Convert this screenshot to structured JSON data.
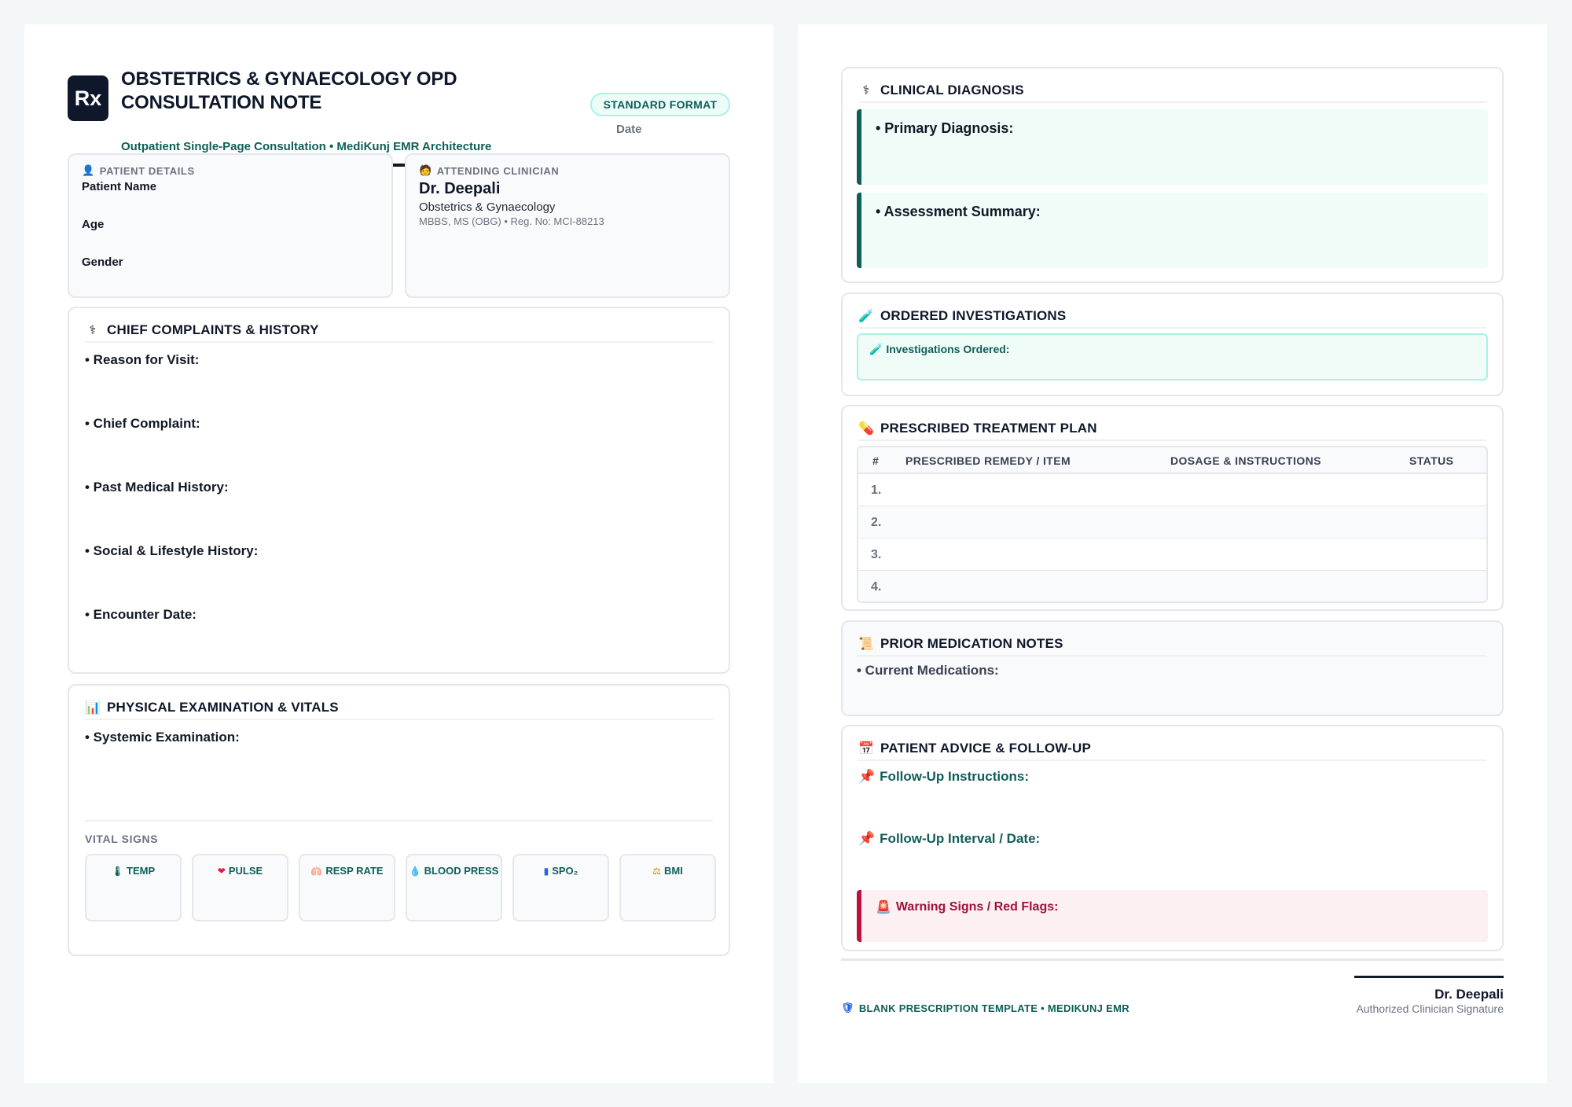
{
  "header": {
    "logo_text": "Rx",
    "title": "OBSTETRICS & GYNAECOLOGY OPD CONSULTATION NOTE",
    "subtitle": "Outpatient Single-Page Consultation • MediKunj EMR Architecture",
    "badge": "STANDARD FORMAT",
    "date_label": "Date"
  },
  "patient": {
    "caption": "PATIENT DETAILS",
    "icon": "person-icon",
    "fields": [
      "Patient Name",
      "Age",
      "Gender"
    ]
  },
  "clinician": {
    "caption": "ATTENDING CLINICIAN",
    "icon": "doctor-icon",
    "name": "Dr. Deepali",
    "specialty": "Obstetrics & Gynaecology",
    "credentials": "MBBS, MS (OBG) • Reg. No: MCI-88213"
  },
  "complaints": {
    "title": "CHIEF COMPLAINTS & HISTORY",
    "icon": "stethoscope-icon",
    "items": [
      "• Reason for Visit:",
      "• Chief Complaint:",
      "• Past Medical History:",
      "• Social & Lifestyle History:",
      "• Encounter Date:"
    ]
  },
  "exam": {
    "title": "PHYSICAL EXAMINATION & VITALS",
    "icon": "chart-icon",
    "systemic": "• Systemic Examination:",
    "vitals_caption": "VITAL SIGNS",
    "vitals": [
      {
        "icon": "thermometer-icon",
        "glyph": "🌡",
        "label": "TEMP"
      },
      {
        "icon": "heart-icon",
        "glyph": "❤",
        "label": "PULSE"
      },
      {
        "icon": "lungs-icon",
        "glyph": "🫁",
        "label": "RESP RATE"
      },
      {
        "icon": "blood-drop-icon",
        "glyph": "💧",
        "label": "BLOOD PRESS"
      },
      {
        "icon": "oximeter-icon",
        "glyph": "▮",
        "label": "SPO₂"
      },
      {
        "icon": "scale-icon",
        "glyph": "⚖",
        "label": "BMI"
      }
    ]
  },
  "diagnosis": {
    "title": "CLINICAL DIAGNOSIS",
    "icon": "stethoscope-icon",
    "primary": "• Primary Diagnosis:",
    "assessment": "• Assessment Summary:"
  },
  "investigations": {
    "title": "ORDERED INVESTIGATIONS",
    "icon": "test-tube-icon",
    "box_label": "Investigations Ordered:"
  },
  "treatment": {
    "title": "PRESCRIBED TREATMENT PLAN",
    "icon": "pill-icon",
    "columns": [
      "#",
      "PRESCRIBED REMEDY / ITEM",
      "DOSAGE & INSTRUCTIONS",
      "STATUS"
    ],
    "rows": [
      "1.",
      "2.",
      "3.",
      "4."
    ]
  },
  "prior_meds": {
    "title": "PRIOR MEDICATION NOTES",
    "icon": "scroll-icon",
    "current": "• Current Medications:"
  },
  "advice": {
    "title": "PATIENT ADVICE & FOLLOW-UP",
    "icon": "calendar-icon",
    "instructions": "Follow-Up Instructions:",
    "interval": "Follow-Up Interval / Date:",
    "warning": "Warning Signs / Red Flags:"
  },
  "footer": {
    "tag": "BLANK PRESCRIPTION TEMPLATE • MEDIKUNJ EMR",
    "signer": "Dr. Deepali",
    "signature_caption": "Authorized Clinician Signature"
  },
  "colors": {
    "accent": "#0f5e57",
    "warning": "#be123c",
    "ink": "#0f172a"
  }
}
